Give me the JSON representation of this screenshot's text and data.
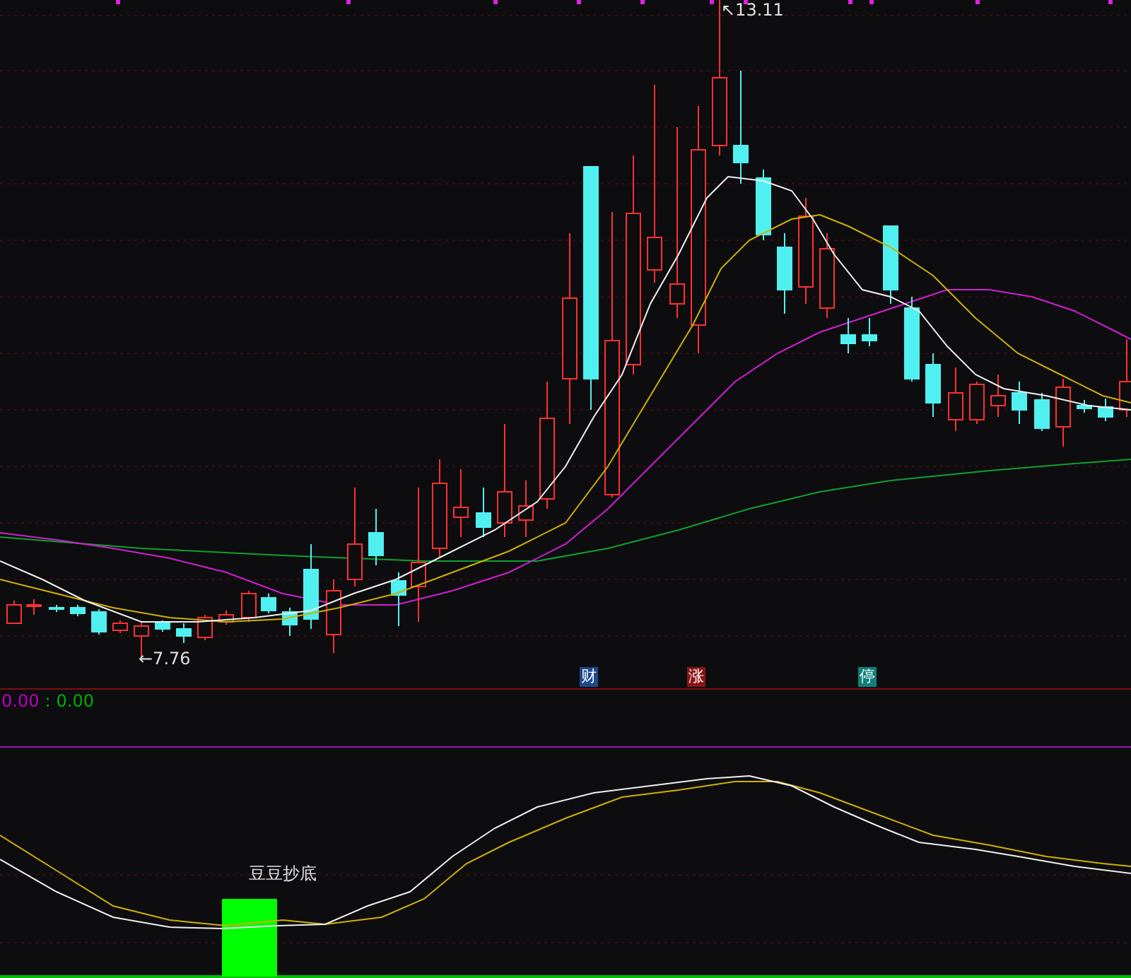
{
  "price_panel": {
    "high_label": "↖13.11",
    "low_label": "←7.76",
    "event_tags": [
      {
        "label": "财",
        "color": "#1e4a8c"
      },
      {
        "label": "涨",
        "color": "#8c1414"
      },
      {
        "label": "停",
        "color": "#12807a"
      }
    ]
  },
  "indicator_readout": {
    "values": [
      {
        "value": "0.00",
        "color": "#c000c0"
      },
      {
        "value": "0.00",
        "color": "#00b000"
      }
    ],
    "separator": ":"
  },
  "indicator_panel": {
    "signal_label": "豆豆抄底"
  }
}
